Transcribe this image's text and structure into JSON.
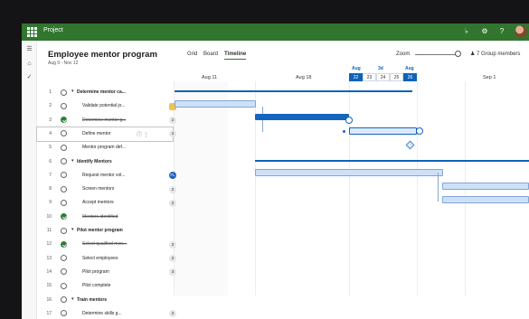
{
  "app": {
    "name": "Project"
  },
  "header": {
    "title": "Employee mentor program",
    "date_range": "Aug 9 - Nov 12",
    "views": [
      "Grid",
      "Board",
      "Timeline"
    ],
    "active_view": "Timeline",
    "zoom_label": "Zoom",
    "members": "7 Group members"
  },
  "timeline": {
    "week_labels": [
      "Aug 11",
      "Aug 18",
      "Sep 1"
    ],
    "months": {
      "left": "Aug",
      "mid": "3d",
      "right": "Aug"
    },
    "days": [
      "22",
      "23",
      "24",
      "25",
      "26"
    ],
    "selected_days": [
      "22",
      "26"
    ]
  },
  "tasks": [
    {
      "num": "1",
      "name": "Determine mentor ca...",
      "type": "summary",
      "status": "open",
      "badge": ""
    },
    {
      "num": "2",
      "name": "Validate potential jo...",
      "type": "task",
      "status": "partial",
      "badge": "lock"
    },
    {
      "num": "3",
      "name": "Determine mentor g...",
      "type": "task",
      "status": "done",
      "badge": "2"
    },
    {
      "num": "4",
      "name": "Define mentor",
      "type": "task",
      "status": "open",
      "badge": "2"
    },
    {
      "num": "5",
      "name": "Mentor program def...",
      "type": "task",
      "status": "open",
      "badge": ""
    },
    {
      "num": "6",
      "name": "Identify Mentors",
      "type": "summary",
      "status": "open",
      "badge": ""
    },
    {
      "num": "7",
      "name": "Request mentor vol...",
      "type": "task",
      "status": "open",
      "badge": "FL"
    },
    {
      "num": "8",
      "name": "Screen mentors",
      "type": "task",
      "status": "open",
      "badge": "2"
    },
    {
      "num": "9",
      "name": "Accept mentors",
      "type": "task",
      "status": "open",
      "badge": "2"
    },
    {
      "num": "10",
      "name": "Mentors identified",
      "type": "task",
      "status": "done",
      "badge": ""
    },
    {
      "num": "11",
      "name": "Pilot mentor program",
      "type": "summary",
      "status": "open",
      "badge": ""
    },
    {
      "num": "12",
      "name": "Select qualified men...",
      "type": "task",
      "status": "done",
      "badge": "2"
    },
    {
      "num": "13",
      "name": "Select employees",
      "type": "task",
      "status": "open",
      "badge": "2"
    },
    {
      "num": "14",
      "name": "Pilot program",
      "type": "task",
      "status": "open",
      "badge": "3"
    },
    {
      "num": "15",
      "name": "Pilot complete",
      "type": "task",
      "status": "open",
      "badge": ""
    },
    {
      "num": "16",
      "name": "Train mentors",
      "type": "summary",
      "status": "open",
      "badge": ""
    },
    {
      "num": "17",
      "name": "Determine skills g...",
      "type": "task",
      "status": "open",
      "badge": "2"
    }
  ],
  "selected_task": "4",
  "colors": {
    "appbar": "#31752f",
    "accent": "#0f62b8",
    "bar": "#cfe0f6"
  }
}
